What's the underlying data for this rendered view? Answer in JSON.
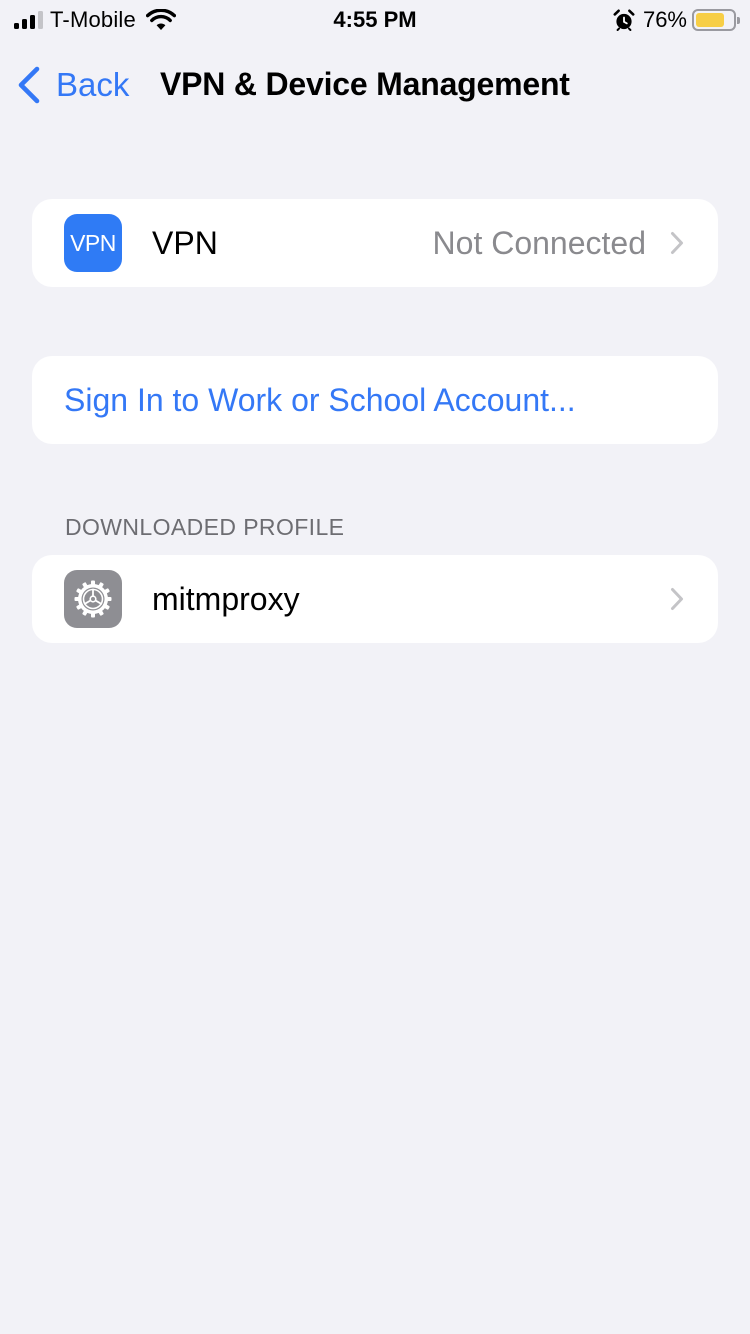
{
  "status_bar": {
    "carrier": "T-Mobile",
    "signal_bars_total": 4,
    "signal_bars_active": 3,
    "time": "4:55 PM",
    "alarm_icon": "alarm-clock-icon",
    "battery_percent_label": "76%",
    "battery_level": 0.76,
    "battery_color": "#F7CE46"
  },
  "nav": {
    "back_label": "Back",
    "title": "VPN & Device Management"
  },
  "vpn_cell": {
    "icon_text": "VPN",
    "icon_color": "#2F7BF5",
    "title": "VPN",
    "detail": "Not Connected"
  },
  "account_cell": {
    "label": "Sign In to Work or School Account..."
  },
  "downloaded_profile": {
    "header": "DOWNLOADED PROFILE",
    "items": [
      {
        "icon": "settings-gear-icon",
        "title": "mitmproxy"
      }
    ]
  },
  "colors": {
    "accent": "#3478F6",
    "background": "#F2F2F7",
    "secondary_text": "#8A8A8E"
  }
}
